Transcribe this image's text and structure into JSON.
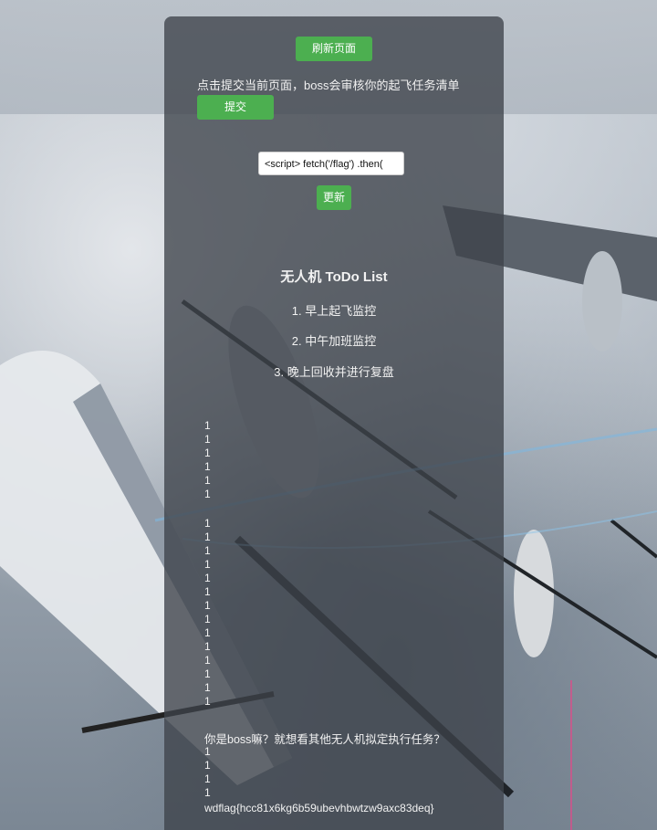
{
  "header": {
    "refresh_label": "刷新页面",
    "submit_prompt": "点击提交当前页面，boss会审核你的起飞任务清单",
    "submit_label": "提交"
  },
  "editor": {
    "input_value": "<script> fetch('/flag')     .then(",
    "update_label": "更新"
  },
  "todo": {
    "title": "无人机 ToDo List",
    "items": [
      "1. 早上起飞监控",
      "2. 中午加班监控",
      "3. 晚上回收并进行复盘"
    ]
  },
  "output": {
    "group1": [
      "1",
      "1",
      "1",
      "1",
      "1",
      "1"
    ],
    "group2": [
      "1",
      "1",
      "1",
      "1",
      "1",
      "1",
      "1",
      "1",
      "1",
      "1",
      "1",
      "1",
      "1",
      "1"
    ],
    "question": "你是boss嘛？就想看其他无人机拟定执行任务？",
    "group3": [
      "1",
      "1",
      "1",
      "1"
    ],
    "flag": "wdflag{hcc81x6kg6b59ubevhbwtzw9axc83deq}"
  },
  "colors": {
    "accent": "#4caf50",
    "panel": "#3e424a"
  }
}
